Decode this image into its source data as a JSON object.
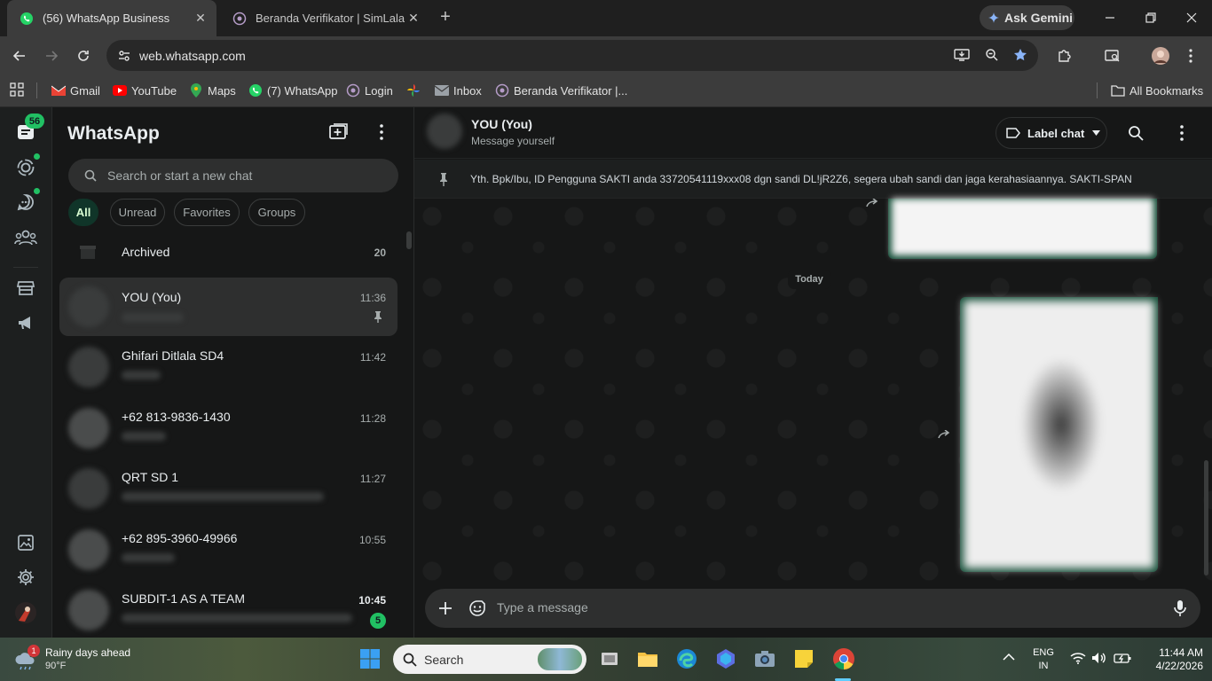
{
  "browser": {
    "tabs": [
      {
        "title": "(56) WhatsApp Business",
        "active": true
      },
      {
        "title": "Beranda Verifikator | SimLala",
        "active": false
      }
    ],
    "url": "web.whatsapp.com",
    "ask_gemini": "Ask Gemini",
    "bookmarks": [
      "Gmail",
      "YouTube",
      "Maps",
      "(7) WhatsApp",
      "Login",
      "Inbox",
      "Beranda Verifikator |..."
    ],
    "all_bookmarks": "All Bookmarks"
  },
  "rail": {
    "chats_badge": "56"
  },
  "sidebar": {
    "title": "WhatsApp",
    "search_placeholder": "Search or start a new chat",
    "filters": [
      "All",
      "Unread",
      "Favorites",
      "Groups"
    ],
    "archived_label": "Archived",
    "archived_count": "20",
    "chats": [
      {
        "name": "YOU (You)",
        "time": "11:36"
      },
      {
        "name": "Ghifari Ditlala SD4",
        "time": "11:42"
      },
      {
        "name": "+62 813-9836-1430",
        "time": "11:28"
      },
      {
        "name": "QRT SD 1",
        "time": "11:27"
      },
      {
        "name": "+62 895-3960-49966",
        "time": "10:55"
      },
      {
        "name": "SUBDIT-1 AS A TEAM",
        "time": "10:45",
        "unread": "5"
      }
    ]
  },
  "conversation": {
    "name": "YOU (You)",
    "subtitle": "Message yourself",
    "label_chat": "Label chat",
    "pinned_message": "Yth. Bpk/Ibu, ID Pengguna SAKTI anda 33720541119xxx08 dgn sandi DL!jR2Z6, segera ubah sandi dan jaga kerahasiaannya. SAKTI-SPAN",
    "date_divider": "Today",
    "input_placeholder": "Type a message"
  },
  "taskbar": {
    "weather_title": "Rainy days ahead",
    "weather_temp": "90°F",
    "weather_badge": "1",
    "search_label": "Search",
    "lang_line1": "ENG",
    "lang_line2": "IN",
    "time": "11:44 AM",
    "date": "4/22/2026"
  }
}
